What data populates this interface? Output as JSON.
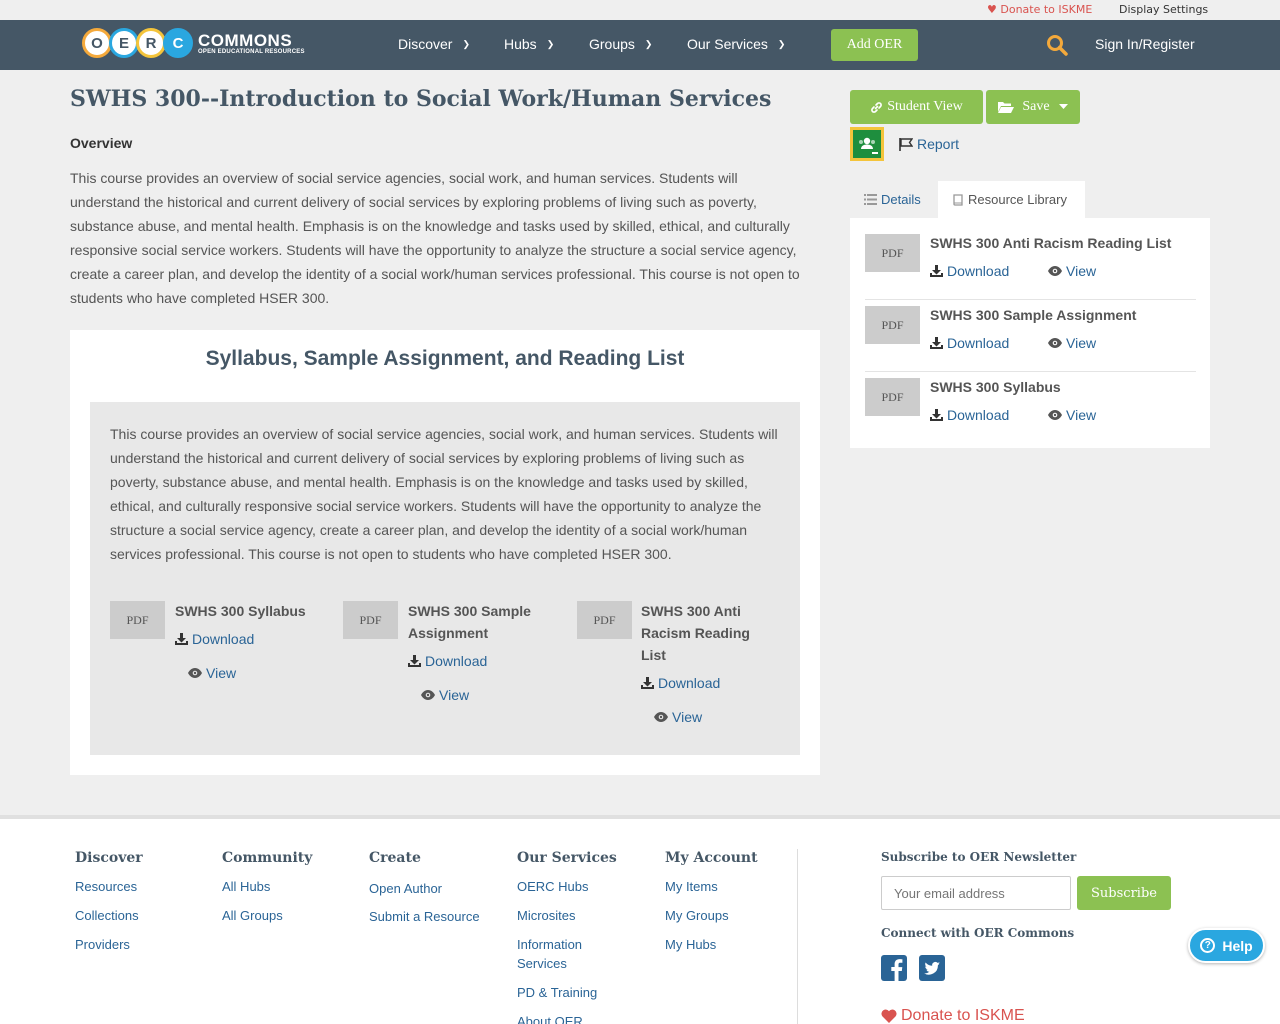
{
  "topbar": {
    "donate": "Donate to ISKME",
    "display_settings": "Display Settings"
  },
  "logo": {
    "letters": [
      "O",
      "E",
      "R"
    ],
    "wordmark": "COMMONS",
    "tagline": "OPEN EDUCATIONAL RESOURCES"
  },
  "nav": {
    "items": [
      "Discover",
      "Hubs",
      "Groups",
      "Our Services"
    ],
    "add_oer": "Add OER",
    "sign_in": "Sign In/Register"
  },
  "page": {
    "title": "SWHS 300--Introduction to Social Work/Human Services",
    "overview_heading": "Overview",
    "overview_text": "This course provides an overview of social service agencies, social work, and human services. Students will understand the historical and current delivery of social services by exploring problems of living such as poverty, substance abuse, and mental health. Emphasis is on the knowledge and tasks used by skilled, ethical, and culturally responsive social service workers. Students will have the opportunity to analyze the structure a social service agency, create a career plan, and develop the identity of a social work/human services professional. This course is not open to students who have completed HSER 300."
  },
  "card": {
    "title": "Syllabus, Sample Assignment, and Reading List",
    "description": "This course provides an overview of social service agencies, social work, and human services. Students will understand the historical and current delivery of social services by exploring problems of living such as poverty, substance abuse, and mental health. Emphasis is on the knowledge and tasks used by skilled, ethical, and culturally responsive social service workers. Students will have the opportunity to analyze the structure a social service agency, create a career plan, and develop the identity of a social work/human services professional. This course is not open to students who have completed HSER 300.",
    "resources": [
      {
        "thumb": "PDF",
        "title": "SWHS 300 Syllabus",
        "download": "Download",
        "view": "View"
      },
      {
        "thumb": "PDF",
        "title": "SWHS 300 Sample Assignment",
        "download": "Download",
        "view": "View"
      },
      {
        "thumb": "PDF",
        "title": "SWHS 300 Anti Racism Reading List",
        "download": "Download",
        "view": "View"
      }
    ]
  },
  "sidebar": {
    "student_view": "Student View",
    "save": "Save",
    "report": "Report",
    "tabs": [
      "Details",
      "Resource Library"
    ],
    "library": [
      {
        "thumb": "PDF",
        "title": "SWHS 300 Anti Racism Reading List",
        "download": "Download",
        "view": "View"
      },
      {
        "thumb": "PDF",
        "title": "SWHS 300 Sample Assignment",
        "download": "Download",
        "view": "View"
      },
      {
        "thumb": "PDF",
        "title": "SWHS 300 Syllabus",
        "download": "Download",
        "view": "View"
      }
    ]
  },
  "footer": {
    "columns": [
      {
        "heading": "Discover",
        "links": [
          "Resources",
          "Collections",
          "Providers"
        ]
      },
      {
        "heading": "Community",
        "links": [
          "All Hubs",
          "All Groups"
        ]
      },
      {
        "heading": "Create",
        "links": [
          "Open Author",
          "Submit a Resource"
        ]
      },
      {
        "heading": "Our Services",
        "links": [
          "OERC Hubs",
          "Microsites",
          "Information Services",
          "PD & Training",
          "About OER"
        ]
      },
      {
        "heading": "My Account",
        "links": [
          "My Items",
          "My Groups",
          "My Hubs"
        ]
      }
    ],
    "newsletter_heading": "Subscribe to OER Newsletter",
    "email_placeholder": "Your email address",
    "subscribe": "Subscribe",
    "connect_heading": "Connect with OER Commons",
    "donate": "Donate to ISKME",
    "help": "Help"
  },
  "colors": {
    "nav_bg": "#455766",
    "accent_green": "#8cc152",
    "link_blue": "#2a6496",
    "donate_red": "#d9534f",
    "logo_orange": "#f4a93b",
    "logo_blue": "#2aa7e0"
  }
}
